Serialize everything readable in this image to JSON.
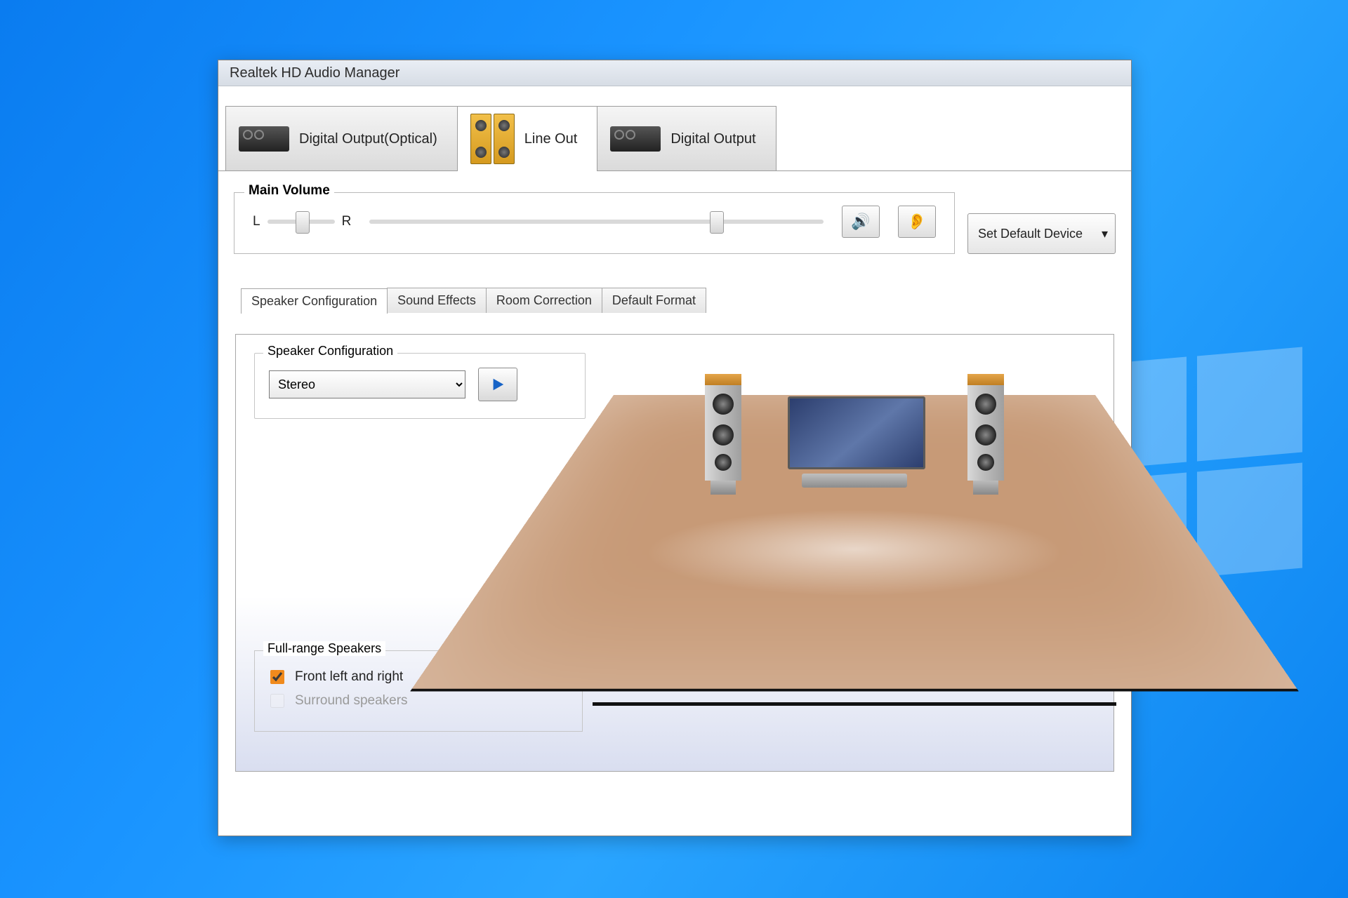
{
  "window": {
    "title": "Realtek HD Audio Manager"
  },
  "device_tabs": [
    {
      "key": "digital_optical",
      "label": "Digital Output(Optical)",
      "icon": "amplifier-icon",
      "active": false
    },
    {
      "key": "line_out",
      "label": "Line Out",
      "icon": "speakers-icon",
      "active": true
    },
    {
      "key": "digital_output",
      "label": "Digital Output",
      "icon": "amplifier-icon",
      "active": false
    }
  ],
  "main_volume": {
    "group_label": "Main Volume",
    "balance": {
      "left_label": "L",
      "right_label": "R",
      "value_percent": 50
    },
    "level_percent": 75,
    "mute_button_title": "Mute",
    "preferences_button_title": "Audio preferences",
    "default_device_button": "Set Default Device"
  },
  "inner_tabs": [
    {
      "label": "Speaker Configuration",
      "active": true
    },
    {
      "label": "Sound Effects",
      "active": false
    },
    {
      "label": "Room Correction",
      "active": false
    },
    {
      "label": "Default Format",
      "active": false
    }
  ],
  "speaker_configuration": {
    "group_label": "Speaker Configuration",
    "selected": "Stereo",
    "options": [
      "Stereo"
    ],
    "play_button_title": "Test"
  },
  "full_range": {
    "group_label": "Full-range Speakers",
    "front_label": "Front left and right",
    "front_checked": true,
    "surround_label": "Surround speakers",
    "surround_checked": false,
    "surround_enabled": false
  }
}
